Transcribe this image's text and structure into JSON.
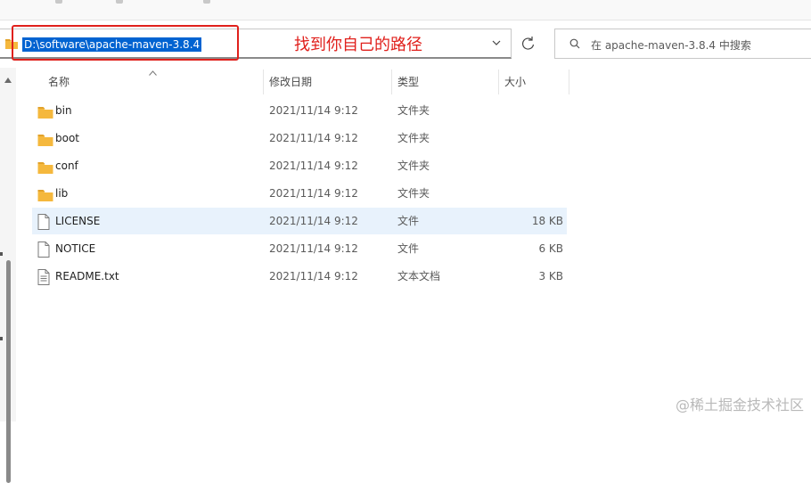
{
  "address_bar": {
    "path": "D:\\software\\apache-maven-3.8.4"
  },
  "annotation": {
    "text": "找到你自己的路径",
    "color": "#e0201c"
  },
  "search": {
    "placeholder": "在 apache-maven-3.8.4 中搜索"
  },
  "columns": {
    "name": "名称",
    "date": "修改日期",
    "type": "类型",
    "size": "大小"
  },
  "files": [
    {
      "icon": "folder-icon",
      "name": "bin",
      "date": "2021/11/14 9:12",
      "type": "文件夹",
      "size": ""
    },
    {
      "icon": "folder-icon",
      "name": "boot",
      "date": "2021/11/14 9:12",
      "type": "文件夹",
      "size": ""
    },
    {
      "icon": "folder-icon",
      "name": "conf",
      "date": "2021/11/14 9:12",
      "type": "文件夹",
      "size": ""
    },
    {
      "icon": "folder-icon",
      "name": "lib",
      "date": "2021/11/14 9:12",
      "type": "文件夹",
      "size": ""
    },
    {
      "icon": "file-icon",
      "name": "LICENSE",
      "date": "2021/11/14 9:12",
      "type": "文件",
      "size": "18 KB",
      "selected": true
    },
    {
      "icon": "file-icon",
      "name": "NOTICE",
      "date": "2021/11/14 9:12",
      "type": "文件",
      "size": "6 KB"
    },
    {
      "icon": "text-file-icon",
      "name": "README.txt",
      "date": "2021/11/14 9:12",
      "type": "文本文档",
      "size": "3 KB"
    }
  ],
  "watermark": "@稀土掘金技术社区",
  "colors": {
    "selection": "#0063d1",
    "row_highlight": "#e8f2fc",
    "folder": "#f5b83d"
  }
}
